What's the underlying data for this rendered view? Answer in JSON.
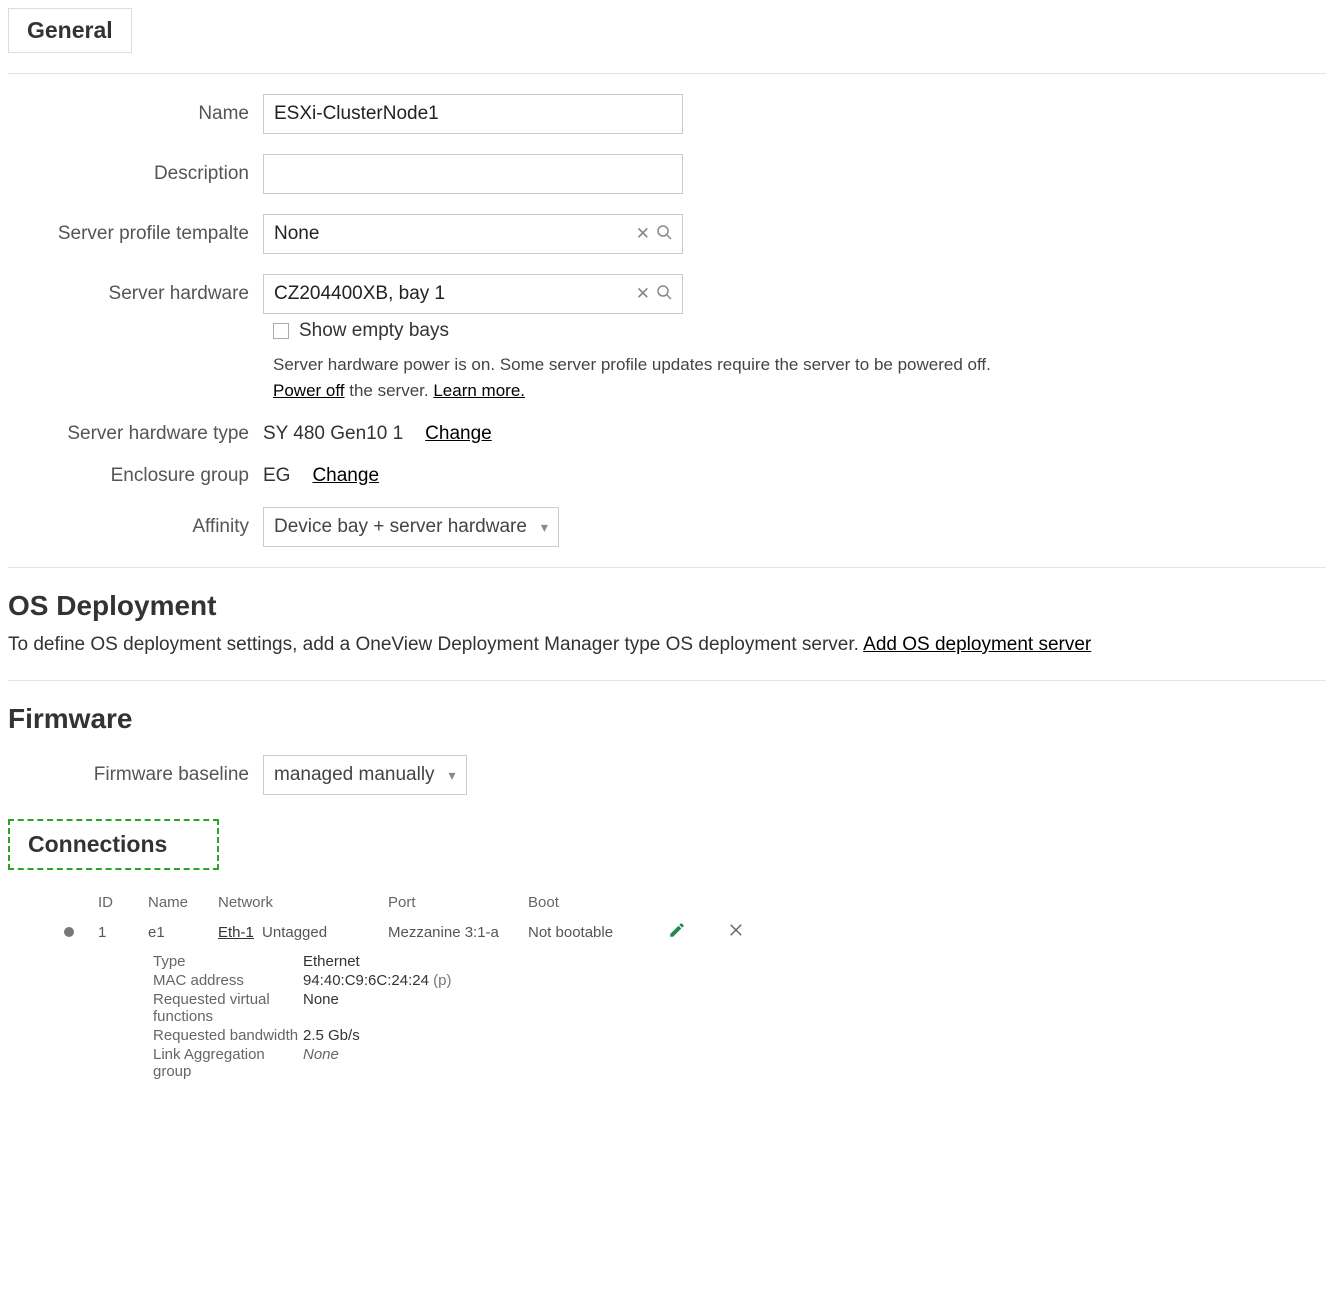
{
  "sections": {
    "general_title": "General",
    "os_title": "OS Deployment",
    "firmware_title": "Firmware",
    "connections_title": "Connections"
  },
  "general": {
    "name_label": "Name",
    "name_value": "ESXi-ClusterNode1",
    "description_label": "Description",
    "description_value": "",
    "template_label": "Server profile tempalte",
    "template_value": "None",
    "hardware_label": "Server hardware",
    "hardware_value": "CZ204400XB, bay 1",
    "show_empty_label": "Show empty bays",
    "power_note_1": "Server hardware power is on. Some server profile updates require the server to be powered off. ",
    "power_off_link": "Power off",
    "power_note_2": " the server. ",
    "learn_more_link": "Learn more.",
    "hw_type_label": "Server hardware type",
    "hw_type_value": "SY 480 Gen10 1",
    "change_link": "Change",
    "enclosure_label": "Enclosure group",
    "enclosure_value": "EG",
    "affinity_label": "Affinity",
    "affinity_value": "Device bay + server hardware"
  },
  "os": {
    "text": "To define OS deployment settings, add a OneView Deployment Manager type OS deployment server. ",
    "link": "Add OS deployment server"
  },
  "firmware": {
    "baseline_label": "Firmware baseline",
    "baseline_value": "managed manually"
  },
  "connections": {
    "headers": {
      "id": "ID",
      "name": "Name",
      "network": "Network",
      "port": "Port",
      "boot": "Boot"
    },
    "rows": [
      {
        "id": "1",
        "name": "e1",
        "network": "Eth-1",
        "tag": "Untagged",
        "port": "Mezzanine 3:1-a",
        "boot": "Not bootable",
        "details": {
          "type_label": "Type",
          "type_value": "Ethernet",
          "mac_label": "MAC address",
          "mac_value": "94:40:C9:6C:24:24",
          "mac_suffix": "(p)",
          "vf_label": "Requested virtual functions",
          "vf_value": "None",
          "bw_label": "Requested bandwidth",
          "bw_value": "2.5 Gb/s",
          "lag_label": "Link Aggregation group",
          "lag_value": "None"
        }
      }
    ]
  }
}
